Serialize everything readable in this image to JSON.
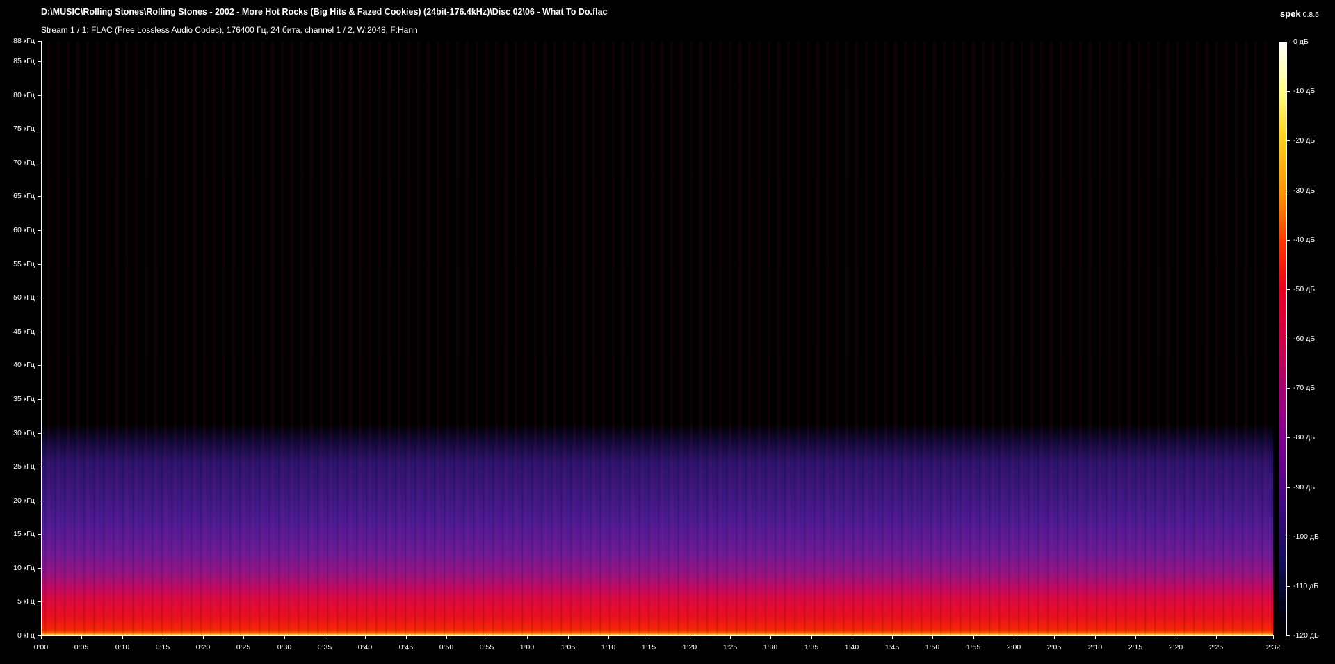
{
  "header": {
    "file_path": "D:\\MUSIC\\Rolling Stones\\Rolling Stones - 2002 - More Hot Rocks (Big Hits & Fazed Cookies) (24bit-176.4kHz)\\Disc 02\\06 - What To Do.flac",
    "stream_info": "Stream 1 / 1: FLAC (Free Lossless Audio Codec), 176400 Гц, 24 бита, channel 1 / 2, W:2048, F:Hann",
    "app_name": "spek",
    "app_version": "0.8.5"
  },
  "spectrogram": {
    "frequency_labels": [
      "88 кГц",
      "85 кГц",
      "80 кГц",
      "75 кГц",
      "70 кГц",
      "65 кГц",
      "60 кГц",
      "55 кГц",
      "50 кГц",
      "45 кГц",
      "40 кГц",
      "35 кГц",
      "30 кГц",
      "25 кГц",
      "20 кГц",
      "15 кГц",
      "10 кГц",
      "5 кГц",
      "0 кГц"
    ],
    "time_labels": [
      "0:00",
      "0:05",
      "0:10",
      "0:15",
      "0:20",
      "0:25",
      "0:30",
      "0:35",
      "0:40",
      "0:45",
      "0:50",
      "0:55",
      "1:00",
      "1:05",
      "1:10",
      "1:15",
      "1:20",
      "1:25",
      "1:30",
      "1:35",
      "1:40",
      "1:45",
      "1:50",
      "1:55",
      "2:00",
      "2:05",
      "2:10",
      "2:15",
      "2:20",
      "2:25",
      "2:32"
    ],
    "colorbar_labels": [
      "0 дБ",
      "-10 дБ",
      "-20 дБ",
      "-30 дБ",
      "-40 дБ",
      "-50 дБ",
      "-60 дБ",
      "-70 дБ",
      "-80 дБ",
      "-90 дБ",
      "-100 дБ",
      "-110 дБ",
      "-120 дБ"
    ],
    "colors": {
      "background": "#000000",
      "low_energy": "#3a177f",
      "mid_energy": "#dc0a3a",
      "high_energy": "#ffb21a",
      "peak": "#ffffff"
    }
  }
}
